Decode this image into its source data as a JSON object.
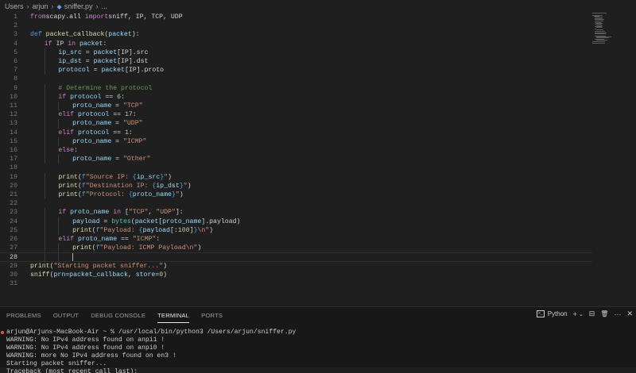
{
  "breadcrumb": {
    "items": [
      "Users",
      "arjun",
      "sniffer.py",
      "..."
    ],
    "file_icon": "python-file-icon"
  },
  "editor": {
    "active_line": 28,
    "lines": [
      {
        "n": "1",
        "indent": 0,
        "t": [
          [
            "kw",
            "from"
          ],
          [
            "",
            "scapy.all "
          ],
          [
            "kw",
            "import"
          ],
          [
            "",
            "sniff, IP, TCP, UDP"
          ]
        ]
      },
      {
        "n": "2",
        "indent": 0,
        "t": []
      },
      {
        "n": "3",
        "indent": 0,
        "t": [
          [
            "kb",
            "def "
          ],
          [
            "fn",
            "packet_callback"
          ],
          [
            "",
            "("
          ],
          [
            "vr",
            "packet"
          ],
          [
            "",
            "):"
          ]
        ]
      },
      {
        "n": "4",
        "indent": 1,
        "t": [
          [
            "kw",
            "if "
          ],
          [
            "",
            "IP "
          ],
          [
            "kw",
            "in "
          ],
          [
            "vr",
            "packet"
          ],
          [
            "",
            ":"
          ]
        ]
      },
      {
        "n": "5",
        "indent": 2,
        "t": [
          [
            "vr",
            "ip_src"
          ],
          [
            "",
            " = "
          ],
          [
            "vr",
            "packet"
          ],
          [
            "",
            "[IP].src"
          ]
        ]
      },
      {
        "n": "6",
        "indent": 2,
        "t": [
          [
            "vr",
            "ip_dst"
          ],
          [
            "",
            " = "
          ],
          [
            "vr",
            "packet"
          ],
          [
            "",
            "[IP].dst"
          ]
        ]
      },
      {
        "n": "7",
        "indent": 2,
        "t": [
          [
            "vr",
            "protocol"
          ],
          [
            "",
            " = "
          ],
          [
            "vr",
            "packet"
          ],
          [
            "",
            "[IP].proto"
          ]
        ]
      },
      {
        "n": "8",
        "indent": 0,
        "t": []
      },
      {
        "n": "9",
        "indent": 2,
        "t": [
          [
            "cm",
            "# Determine the protocol"
          ]
        ]
      },
      {
        "n": "10",
        "indent": 2,
        "t": [
          [
            "kw",
            "if "
          ],
          [
            "vr",
            "protocol"
          ],
          [
            "",
            " == "
          ],
          [
            "nu",
            "6"
          ],
          [
            "",
            ":"
          ]
        ]
      },
      {
        "n": "11",
        "indent": 3,
        "t": [
          [
            "vr",
            "proto_name"
          ],
          [
            "",
            " = "
          ],
          [
            "st",
            "\"TCP\""
          ]
        ]
      },
      {
        "n": "12",
        "indent": 2,
        "t": [
          [
            "kw",
            "elif "
          ],
          [
            "vr",
            "protocol"
          ],
          [
            "",
            " == "
          ],
          [
            "nu",
            "17"
          ],
          [
            "",
            ":"
          ]
        ]
      },
      {
        "n": "13",
        "indent": 3,
        "t": [
          [
            "vr",
            "proto_name"
          ],
          [
            "",
            " = "
          ],
          [
            "st",
            "\"UDP\""
          ]
        ]
      },
      {
        "n": "14",
        "indent": 2,
        "t": [
          [
            "kw",
            "elif "
          ],
          [
            "vr",
            "protocol"
          ],
          [
            "",
            " == "
          ],
          [
            "nu",
            "1"
          ],
          [
            "",
            ":"
          ]
        ]
      },
      {
        "n": "15",
        "indent": 3,
        "t": [
          [
            "vr",
            "proto_name"
          ],
          [
            "",
            " = "
          ],
          [
            "st",
            "\"ICMP\""
          ]
        ]
      },
      {
        "n": "16",
        "indent": 2,
        "t": [
          [
            "kw",
            "else"
          ],
          [
            "",
            ":"
          ]
        ]
      },
      {
        "n": "17",
        "indent": 3,
        "t": [
          [
            "vr",
            "proto_name"
          ],
          [
            "",
            " = "
          ],
          [
            "st",
            "\"Other\""
          ]
        ]
      },
      {
        "n": "18",
        "indent": 0,
        "t": []
      },
      {
        "n": "19",
        "indent": 2,
        "t": [
          [
            "fn",
            "print"
          ],
          [
            "",
            "("
          ],
          [
            "kb",
            "f"
          ],
          [
            "st",
            "\"Source IP: "
          ],
          [
            "kb",
            "{"
          ],
          [
            "vr",
            "ip_src"
          ],
          [
            "kb",
            "}"
          ],
          [
            "st",
            "\""
          ],
          [
            "",
            ")"
          ]
        ]
      },
      {
        "n": "20",
        "indent": 2,
        "t": [
          [
            "fn",
            "print"
          ],
          [
            "",
            "("
          ],
          [
            "kb",
            "f"
          ],
          [
            "st",
            "\"Destination IP: "
          ],
          [
            "kb",
            "{"
          ],
          [
            "vr",
            "ip_dst"
          ],
          [
            "kb",
            "}"
          ],
          [
            "st",
            "\""
          ],
          [
            "",
            ")"
          ]
        ]
      },
      {
        "n": "21",
        "indent": 2,
        "t": [
          [
            "fn",
            "print"
          ],
          [
            "",
            "("
          ],
          [
            "kb",
            "f"
          ],
          [
            "st",
            "\"Protocol: "
          ],
          [
            "kb",
            "{"
          ],
          [
            "vr",
            "proto_name"
          ],
          [
            "kb",
            "}"
          ],
          [
            "st",
            "\""
          ],
          [
            "",
            ")"
          ]
        ]
      },
      {
        "n": "22",
        "indent": 0,
        "t": []
      },
      {
        "n": "23",
        "indent": 2,
        "t": [
          [
            "kw",
            "if "
          ],
          [
            "vr",
            "proto_name"
          ],
          [
            "",
            " "
          ],
          [
            "kw",
            "in "
          ],
          [
            "",
            "["
          ],
          [
            "st",
            "\"TCP\""
          ],
          [
            "",
            ", "
          ],
          [
            "st",
            "\"UDP\""
          ],
          [
            "",
            "]:"
          ]
        ]
      },
      {
        "n": "24",
        "indent": 3,
        "t": [
          [
            "vr",
            "payload"
          ],
          [
            "",
            " = "
          ],
          [
            "ty",
            "bytes"
          ],
          [
            "",
            "("
          ],
          [
            "vr",
            "packet"
          ],
          [
            "",
            "["
          ],
          [
            "vr",
            "proto_name"
          ],
          [
            "",
            "].payload)"
          ]
        ]
      },
      {
        "n": "25",
        "indent": 3,
        "t": [
          [
            "fn",
            "print"
          ],
          [
            "",
            "("
          ],
          [
            "kb",
            "f"
          ],
          [
            "st",
            "\"Payload: "
          ],
          [
            "kb",
            "{"
          ],
          [
            "vr",
            "payload"
          ],
          [
            "",
            "[:"
          ],
          [
            "nu",
            "100"
          ],
          [
            "",
            "]"
          ],
          [
            "kb",
            "}"
          ],
          [
            "st",
            "\\n\""
          ],
          [
            "",
            ")"
          ]
        ]
      },
      {
        "n": "26",
        "indent": 2,
        "t": [
          [
            "kw",
            "elif "
          ],
          [
            "vr",
            "proto_name"
          ],
          [
            "",
            " == "
          ],
          [
            "st",
            "\"ICMP\""
          ],
          [
            "",
            ":"
          ]
        ]
      },
      {
        "n": "27",
        "indent": 3,
        "t": [
          [
            "fn",
            "print"
          ],
          [
            "",
            "("
          ],
          [
            "kb",
            "f"
          ],
          [
            "st",
            "\"Payload: ICMP Payload\\n\""
          ],
          [
            "",
            ")"
          ]
        ]
      },
      {
        "n": "28",
        "indent": 3,
        "t": [],
        "cursor": true
      },
      {
        "n": "29",
        "indent": 0,
        "t": [
          [
            "fn",
            "print"
          ],
          [
            "",
            "("
          ],
          [
            "st",
            "\"Starting packet sniffer...\""
          ],
          [
            "",
            ")"
          ]
        ]
      },
      {
        "n": "30",
        "indent": 0,
        "t": [
          [
            "fn",
            "sniff"
          ],
          [
            "",
            "("
          ],
          [
            "vr",
            "prn"
          ],
          [
            "",
            "="
          ],
          [
            "vr",
            "packet_callback"
          ],
          [
            "",
            ", "
          ],
          [
            "vr",
            "store"
          ],
          [
            "",
            "="
          ],
          [
            "nu",
            "0"
          ],
          [
            "",
            ")"
          ]
        ]
      },
      {
        "n": "31",
        "indent": 0,
        "t": []
      }
    ]
  },
  "panel": {
    "tabs": [
      {
        "label": "PROBLEMS",
        "active": false
      },
      {
        "label": "OUTPUT",
        "active": false
      },
      {
        "label": "DEBUG CONSOLE",
        "active": false
      },
      {
        "label": "TERMINAL",
        "active": true
      },
      {
        "label": "PORTS",
        "active": false
      }
    ],
    "terminal_profile": "Python",
    "actions": [
      "+",
      "⌄",
      "⊟",
      "🗑",
      "···",
      "✕"
    ],
    "terminal_lines": [
      "arjun@Arjuns-MacBook-Air ~ % /usr/local/bin/python3 /Users/arjun/sniffer.py",
      "WARNING: No IPv4 address found on anpi1 !",
      "WARNING: No IPv4 address found on anpi0 !",
      "WARNING: more No IPv4 address found on en3 !",
      "Starting packet sniffer...",
      "Traceback (most recent call last):"
    ]
  },
  "colors": {
    "editor_bg": "#1f1f1f",
    "panel_bg": "#181818",
    "keyword": "#c586c0",
    "string": "#ce9178",
    "function": "#dcdcaa",
    "variable": "#9cdcfe",
    "error_dot": "#f14c4c"
  }
}
